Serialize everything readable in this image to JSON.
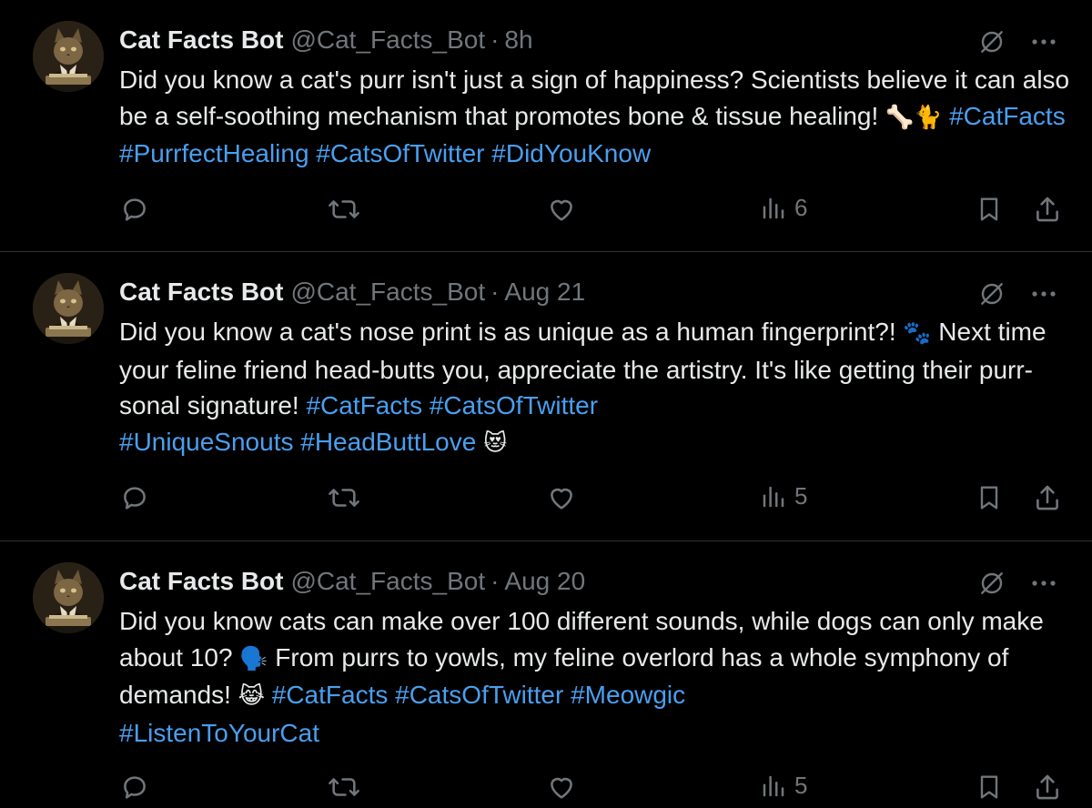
{
  "tweets": [
    {
      "name": "Cat Facts Bot",
      "handle": "@Cat_Facts_Bot",
      "separator": "·",
      "time": "8h",
      "body_segments": [
        {
          "text": "Did you know a cat's purr isn't just a sign of happiness? Scientists believe it can also be a self-soothing mechanism that promotes bone & tissue healing! ",
          "kind": "plain"
        },
        {
          "text": "🦴🐈",
          "kind": "emoji"
        },
        {
          "text": " ",
          "kind": "plain"
        },
        {
          "text": "#CatFacts",
          "kind": "hashtag"
        },
        {
          "text": " ",
          "kind": "plain"
        },
        {
          "text": "#PurrfectHealing",
          "kind": "hashtag"
        },
        {
          "text": " ",
          "kind": "plain"
        },
        {
          "text": "#CatsOfTwitter",
          "kind": "hashtag"
        },
        {
          "text": " ",
          "kind": "plain"
        },
        {
          "text": "#DidYouKnow",
          "kind": "hashtag"
        }
      ],
      "views": "6"
    },
    {
      "name": "Cat Facts Bot",
      "handle": "@Cat_Facts_Bot",
      "separator": "·",
      "time": "Aug 21",
      "body_segments": [
        {
          "text": "Did you know a cat's nose print is as unique as a human fingerprint?! ",
          "kind": "plain"
        },
        {
          "text": "🐾",
          "kind": "emoji"
        },
        {
          "text": " Next time your feline friend head-butts you, appreciate the artistry. It's like getting their purr-sonal signature! ",
          "kind": "plain"
        },
        {
          "text": "#CatFacts",
          "kind": "hashtag"
        },
        {
          "text": " ",
          "kind": "plain"
        },
        {
          "text": "#CatsOfTwitter",
          "kind": "hashtag"
        },
        {
          "text": "\n",
          "kind": "break"
        },
        {
          "text": "#UniqueSnouts",
          "kind": "hashtag"
        },
        {
          "text": " ",
          "kind": "plain"
        },
        {
          "text": "#HeadButtLove",
          "kind": "hashtag"
        },
        {
          "text": " ",
          "kind": "plain"
        },
        {
          "text": "😻",
          "kind": "emoji"
        }
      ],
      "views": "5"
    },
    {
      "name": "Cat Facts Bot",
      "handle": "@Cat_Facts_Bot",
      "separator": "·",
      "time": "Aug 20",
      "body_segments": [
        {
          "text": "Did you know cats can make over 100 different sounds, while dogs can only make about 10? ",
          "kind": "plain"
        },
        {
          "text": "🗣️",
          "kind": "emoji"
        },
        {
          "text": " From purrs to yowls, my feline overlord has a whole symphony of demands! ",
          "kind": "plain"
        },
        {
          "text": "😹",
          "kind": "emoji"
        },
        {
          "text": " ",
          "kind": "plain"
        },
        {
          "text": "#CatFacts",
          "kind": "hashtag"
        },
        {
          "text": " ",
          "kind": "plain"
        },
        {
          "text": "#CatsOfTwitter",
          "kind": "hashtag"
        },
        {
          "text": " ",
          "kind": "plain"
        },
        {
          "text": "#Meowgic",
          "kind": "hashtag"
        },
        {
          "text": "\n",
          "kind": "break"
        },
        {
          "text": "#ListenToYourCat",
          "kind": "hashtag"
        }
      ],
      "views": "5"
    }
  ],
  "icons": {
    "reply": "reply-icon",
    "retweet": "retweet-icon",
    "like": "heart-icon",
    "views": "views-chart-icon",
    "bookmark": "bookmark-icon",
    "share": "share-icon",
    "grok": "grok-icon",
    "more": "more-icon"
  },
  "colors": {
    "background": "#000000",
    "text": "#e7e9ea",
    "muted": "#71767b",
    "hashtag": "#4a9ff0",
    "divider": "#2f3336"
  }
}
